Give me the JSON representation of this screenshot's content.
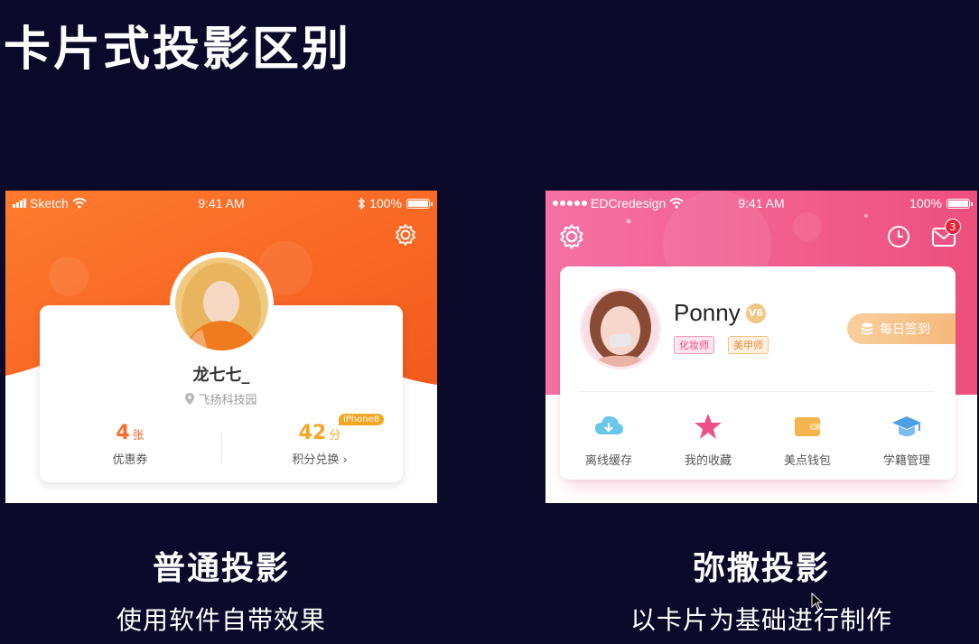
{
  "slide": {
    "title": "卡片式投影区别",
    "background": "#0b0a2a"
  },
  "left_demo": {
    "statusbar": {
      "carrier": "Sketch",
      "time": "9:41 AM",
      "battery": "100%"
    },
    "accent": "#ff6a2c",
    "profile": {
      "name": "龙七七_",
      "location": "飞扬科技园"
    },
    "stats": {
      "coupon": {
        "value": "4",
        "unit": "张",
        "label": "优惠券"
      },
      "points": {
        "value": "42",
        "unit": "分",
        "label": "积分兑换 ›",
        "badge": "iPhone8"
      }
    },
    "icons": [
      "gear-icon",
      "location-pin-icon",
      "wifi-icon",
      "bluetooth-icon"
    ],
    "caption": {
      "title": "普通投影",
      "subtitle": "使用软件自带效果"
    }
  },
  "right_demo": {
    "statusbar": {
      "carrier": "EDCredesign",
      "time": "9:41 AM",
      "battery": "100%"
    },
    "accent": "#ee5a8c",
    "profile": {
      "name": "Ponny",
      "level_badge": "V6",
      "tags": [
        "化妆师",
        "美甲师"
      ],
      "checkin_label": "每日签到"
    },
    "mail_count": "3",
    "menu": [
      {
        "label": "离线缓存",
        "icon": "cloud-download-icon"
      },
      {
        "label": "我的收藏",
        "icon": "star-icon"
      },
      {
        "label": "美点钱包",
        "icon": "wallet-icon"
      },
      {
        "label": "学籍管理",
        "icon": "graduation-cap-icon"
      }
    ],
    "caption": {
      "title": "弥撒投影",
      "subtitle": "以卡片为基础进行制作"
    }
  }
}
